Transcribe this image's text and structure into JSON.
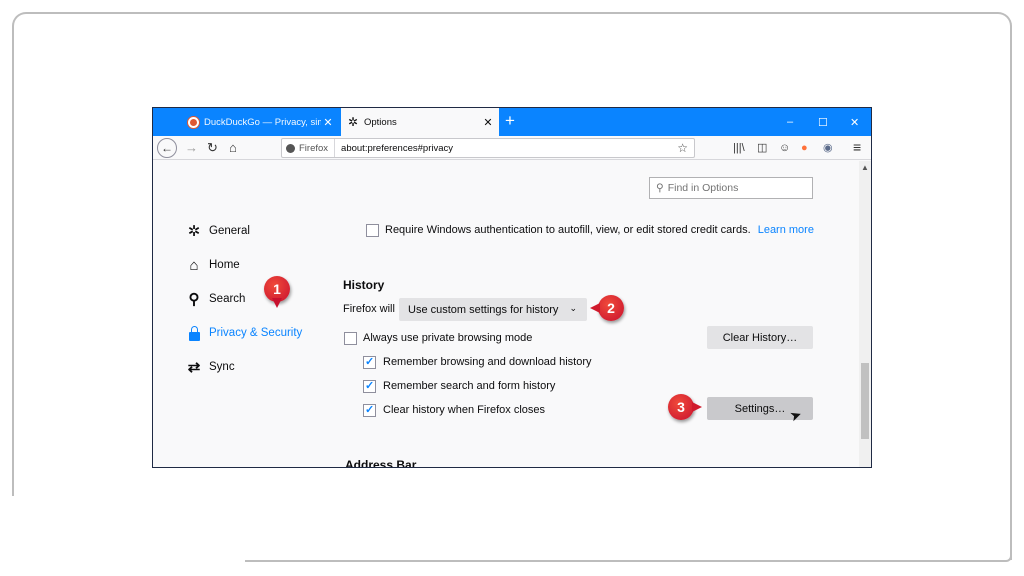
{
  "tabs": [
    {
      "title": "DuckDuckGo — Privacy, simplified.",
      "icon": "duckduckgo-icon"
    },
    {
      "title": "Options",
      "icon": "gear-icon"
    }
  ],
  "navbar": {
    "identity": "Firefox",
    "url": "about:preferences#privacy"
  },
  "search": {
    "placeholder": "Find in Options"
  },
  "sidebar": {
    "items": [
      {
        "label": "General",
        "icon": "gear-icon"
      },
      {
        "label": "Home",
        "icon": "home-icon"
      },
      {
        "label": "Search",
        "icon": "search-icon"
      },
      {
        "label": "Privacy & Security",
        "icon": "lock-icon"
      },
      {
        "label": "Sync",
        "icon": "sync-icon"
      }
    ]
  },
  "content": {
    "win_auth_label": "Require Windows authentication to autofill, view, or edit stored credit cards.",
    "learn_more": "Learn more",
    "history_heading": "History",
    "firefox_will_label": "Firefox will",
    "history_select_value": "Use custom settings for history",
    "always_private_label": "Always use private browsing mode",
    "clear_history_button": "Clear History…",
    "remember_browsing_label": "Remember browsing and download history",
    "remember_search_label": "Remember search and form history",
    "clear_on_close_label": "Clear history when Firefox closes",
    "settings_button": "Settings…",
    "address_bar_heading": "Address Bar"
  },
  "callouts": [
    "1",
    "2",
    "3"
  ],
  "colors": {
    "accent": "#0a84ff",
    "callout": "#d01a2c",
    "tabbar": "#0a84ff"
  }
}
